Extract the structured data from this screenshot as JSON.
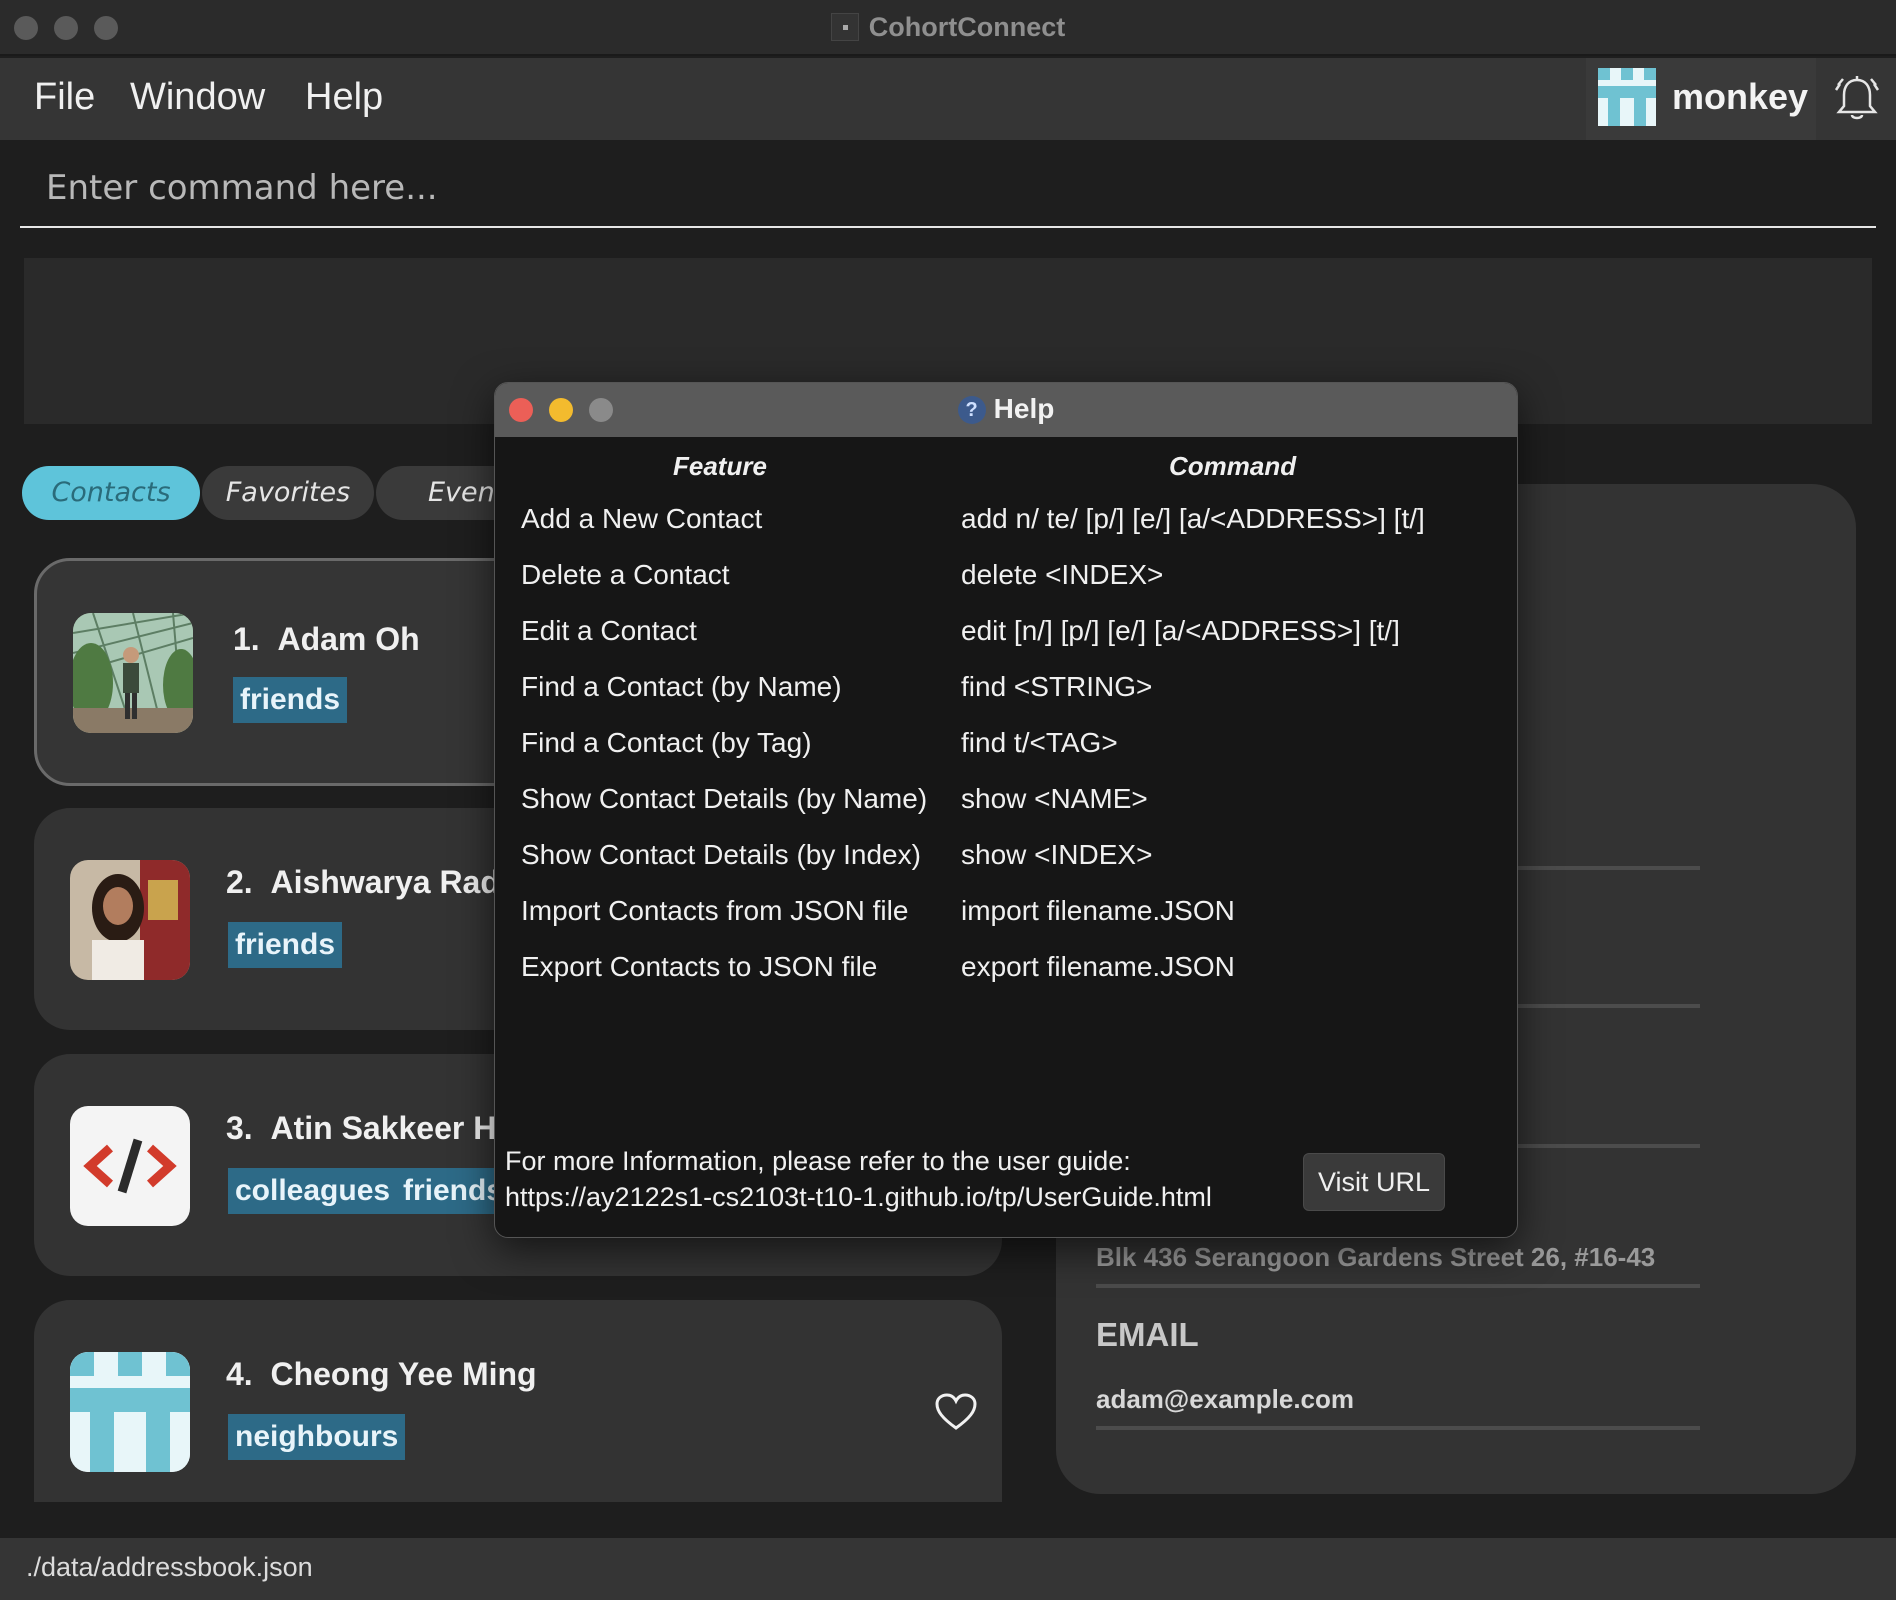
{
  "window": {
    "title": "CohortConnect"
  },
  "menu": {
    "items": [
      "File",
      "Window",
      "Help"
    ]
  },
  "user": {
    "name": "monkey"
  },
  "command": {
    "placeholder": "Enter command here..."
  },
  "tabs": [
    "Contacts",
    "Favorites",
    "Events"
  ],
  "contacts": [
    {
      "index": "1.",
      "name": "Adam Oh",
      "tags": [
        "friends"
      ]
    },
    {
      "index": "2.",
      "name": "Aishwarya Radh",
      "tags": [
        "friends"
      ]
    },
    {
      "index": "3.",
      "name": "Atin Sakkeer Hu",
      "tags": [
        "colleagues",
        "friends"
      ]
    },
    {
      "index": "4.",
      "name": "Cheong Yee Ming",
      "tags": [
        "neighbours"
      ]
    }
  ],
  "details": {
    "address": "Blk 436 Serangoon Gardens Street 26, #16-43",
    "email_label": "EMAIL",
    "email": "adam@example.com"
  },
  "statusbar": {
    "path": "./data/addressbook.json"
  },
  "help": {
    "title": "Help",
    "feature_header": "Feature",
    "command_header": "Command",
    "rows": [
      {
        "feature": "Add a New Contact",
        "command": "add n/ te/ [p/] [e/] [a/<ADDRESS>] [t/]"
      },
      {
        "feature": "Delete a Contact",
        "command": "delete <INDEX>"
      },
      {
        "feature": "Edit a Contact",
        "command": "edit [n/] [p/] [e/] [a/<ADDRESS>] [t/]"
      },
      {
        "feature": "Find a Contact (by Name)",
        "command": "find <STRING>"
      },
      {
        "feature": "Find a Contact (by Tag)",
        "command": "find t/<TAG>"
      },
      {
        "feature": "Show Contact Details (by Name)",
        "command": "show <NAME>"
      },
      {
        "feature": "Show Contact Details (by Index)",
        "command": "show <INDEX>"
      },
      {
        "feature": "Import Contacts from JSON file",
        "command": "import filename.JSON"
      },
      {
        "feature": "Export Contacts to JSON file",
        "command": "export filename.JSON"
      }
    ],
    "footer_line1": "For more Information, please refer to the user guide:",
    "footer_url": "https://ay2122s1-cs2103t-t10-1.github.io/tp/UserGuide.html",
    "visit_button": "Visit URL"
  }
}
